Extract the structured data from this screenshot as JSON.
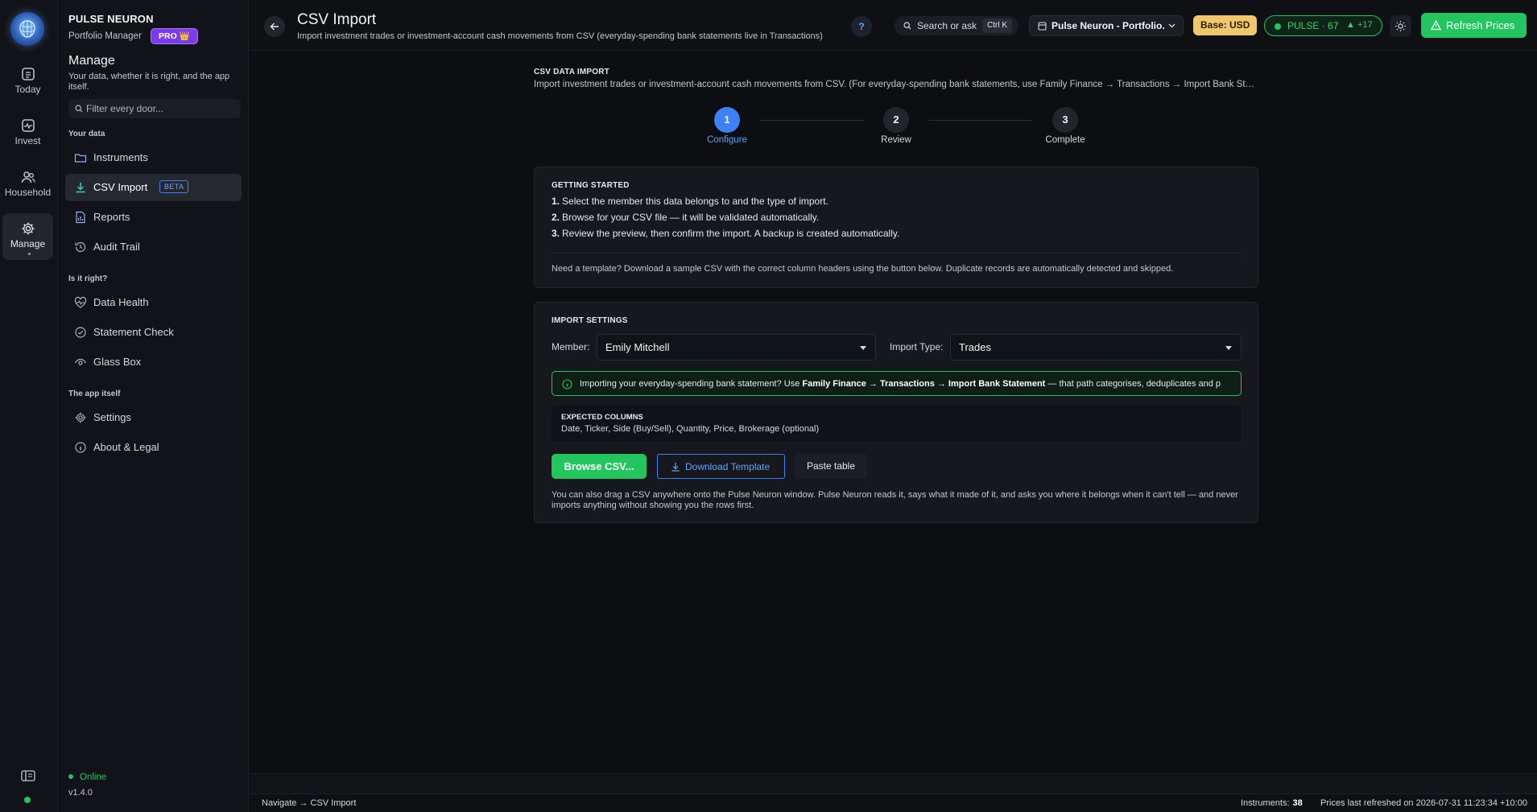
{
  "app": {
    "brand": "PULSE NEURON",
    "subtitle": "Portfolio Manager",
    "badge": "PRO 👑"
  },
  "rail": {
    "items": [
      {
        "label": "Today",
        "icon": "calendar-icon"
      },
      {
        "label": "Invest",
        "icon": "activity-icon"
      },
      {
        "label": "Household",
        "icon": "users-icon"
      },
      {
        "label": "Manage",
        "icon": "gear-icon",
        "active": true
      }
    ]
  },
  "sidebar": {
    "title": "Manage",
    "description": "Your data, whether it is right, and the app itself.",
    "filter_placeholder": "Filter every door...",
    "groups": [
      {
        "label": "Your data",
        "items": [
          {
            "label": "Instruments",
            "icon": "folder-icon"
          },
          {
            "label": "CSV Import",
            "icon": "download-icon",
            "badge": "BETA",
            "active": true
          },
          {
            "label": "Reports",
            "icon": "report-icon"
          },
          {
            "label": "Audit Trail",
            "icon": "history-icon"
          }
        ]
      },
      {
        "label": "Is it right?",
        "items": [
          {
            "label": "Data Health",
            "icon": "heartbeat-icon"
          },
          {
            "label": "Statement Check",
            "icon": "check-circle-icon"
          },
          {
            "label": "Glass Box",
            "icon": "eye-icon"
          }
        ]
      },
      {
        "label": "The app itself",
        "items": [
          {
            "label": "Settings",
            "icon": "gear-icon"
          },
          {
            "label": "About & Legal",
            "icon": "info-icon"
          }
        ]
      }
    ],
    "status": "Online",
    "version": "v1.4.0"
  },
  "header": {
    "title": "CSV Import",
    "subtitle": "Import investment trades or investment-account cash movements from CSV (everyday-spending bank statements live in Transactions)",
    "help": "?",
    "search_label": "Search or ask",
    "search_shortcut": "Ctrl K",
    "portfolio": "Pulse Neuron - Portfolio...",
    "base_currency": "Base: USD",
    "pulse": "PULSE · 67",
    "pulse_change": "▲ +17",
    "refresh_label": "Refresh Prices"
  },
  "import": {
    "title": "CSV DATA IMPORT",
    "description": "Import investment trades or investment-account cash movements from CSV. (For everyday-spending bank statements, use Family Finance → Transactions → Import Bank Statement.)",
    "steps": [
      {
        "number": "1",
        "label": "Configure",
        "active": true
      },
      {
        "number": "2",
        "label": "Review"
      },
      {
        "number": "3",
        "label": "Complete"
      }
    ],
    "getting_started": {
      "title": "GETTING STARTED",
      "steps": [
        {
          "num": "1.",
          "text": "Select the member this data belongs to and the type of import."
        },
        {
          "num": "2.",
          "text": "Browse for your CSV file — it will be validated automatically."
        },
        {
          "num": "3.",
          "text": "Review the preview, then confirm the import. A backup is created automatically."
        }
      ],
      "note": "Need a template? Download a sample CSV with the correct column headers using the button below. Duplicate records are automatically detected and skipped."
    },
    "settings": {
      "title": "IMPORT SETTINGS",
      "member_label": "Member:",
      "member_value": "Emily Mitchell",
      "type_label": "Import Type:",
      "type_value": "Trades",
      "banner_prefix": "Importing your everyday-spending bank statement? Use ",
      "banner_path": "Family Finance → Transactions → Import Bank Statement",
      "banner_suffix": " — that path categorises, deduplicates and p",
      "expected_title": "EXPECTED COLUMNS",
      "expected_value": "Date, Ticker, Side (Buy/Sell), Quantity, Price, Brokerage (optional)",
      "browse_label": "Browse CSV...",
      "template_label": "Download Template",
      "paste_label": "Paste table",
      "drag_note": "You can also drag a CSV anywhere onto the Pulse Neuron window. Pulse Neuron reads it, says what it made of it, and asks you where it belongs when it can't tell — and never imports anything without showing you the rows first."
    }
  },
  "footer": {
    "breadcrumb": "Navigate → CSV Import",
    "instruments_label": "Instruments:",
    "instruments_count": "38",
    "refreshed": "Prices last refreshed on 2026-07-31 11:23:34 +10:00"
  },
  "colors": {
    "accent_blue": "#3b82f6",
    "accent_green": "#22c55e",
    "pro_purple": "#7c3aed",
    "base_gold": "#f2c66d"
  }
}
